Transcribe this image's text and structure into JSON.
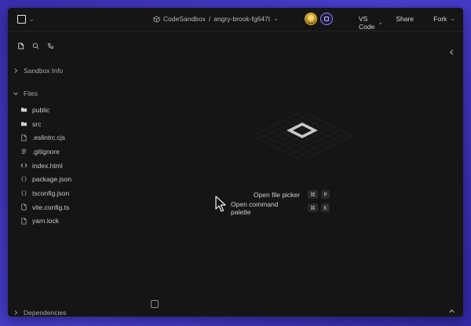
{
  "topbar": {
    "breadcrumb_app": "CodeSandbox",
    "breadcrumb_sep": "/",
    "breadcrumb_project": "angry-brook-fg647t",
    "editor_label": "VS Code",
    "share_label": "Share",
    "fork_label": "Fork"
  },
  "sidebar": {
    "sandbox_info": "Sandbox Info",
    "files": "Files",
    "dependencies": "Dependencies",
    "items": [
      {
        "name": "public",
        "icon": "folder-icon"
      },
      {
        "name": "src",
        "icon": "folder-icon"
      },
      {
        "name": ".eslintrc.cjs",
        "icon": "file-icon"
      },
      {
        "name": ".gitignore",
        "icon": "lines-icon"
      },
      {
        "name": "index.html",
        "icon": "code-icon"
      },
      {
        "name": "package.json",
        "icon": "braces-icon"
      },
      {
        "name": "tsconfig.json",
        "icon": "braces-icon"
      },
      {
        "name": "vite.config.ts",
        "icon": "file-icon"
      },
      {
        "name": "yarn.lock",
        "icon": "file-icon"
      }
    ]
  },
  "editor": {
    "shortcuts": [
      {
        "label": "Open file picker",
        "keys": [
          "⌘",
          "P"
        ]
      },
      {
        "label": "Open command palette",
        "keys": [
          "⌘",
          "K"
        ]
      }
    ]
  },
  "colors": {
    "background": "#3a2fb0",
    "window": "#151515",
    "accent": "#8c83ff"
  }
}
